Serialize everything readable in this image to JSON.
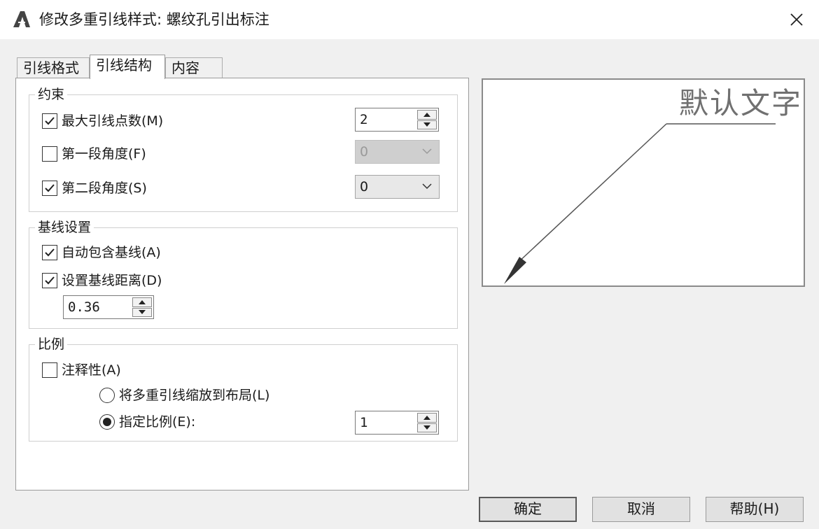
{
  "window": {
    "title": "修改多重引线样式: 螺纹孔引出标注"
  },
  "tabs": [
    {
      "label": "引线格式"
    },
    {
      "label": "引线结构"
    },
    {
      "label": "内容"
    }
  ],
  "constraints": {
    "title": "约束",
    "max_points": {
      "label": "最大引线点数(M)",
      "checked": true,
      "value": "2"
    },
    "first_angle": {
      "label": "第一段角度(F)",
      "checked": false,
      "value": "0"
    },
    "second_angle": {
      "label": "第二段角度(S)",
      "checked": true,
      "value": "0"
    }
  },
  "landing": {
    "title": "基线设置",
    "auto_include": {
      "label": "自动包含基线(A)",
      "checked": true
    },
    "set_distance": {
      "label": "设置基线距离(D)",
      "checked": true
    },
    "distance_value": "0.36"
  },
  "scale": {
    "title": "比例",
    "annotative": {
      "label": "注释性(A)",
      "checked": false
    },
    "scale_to_layout": {
      "label": "将多重引线缩放到布局(L)",
      "selected": false
    },
    "specify_scale": {
      "label": "指定比例(E):",
      "selected": true
    },
    "scale_value": "1"
  },
  "preview": {
    "text": "默认文字"
  },
  "buttons": {
    "ok": "确定",
    "cancel": "取消",
    "help": "帮助(H)"
  }
}
